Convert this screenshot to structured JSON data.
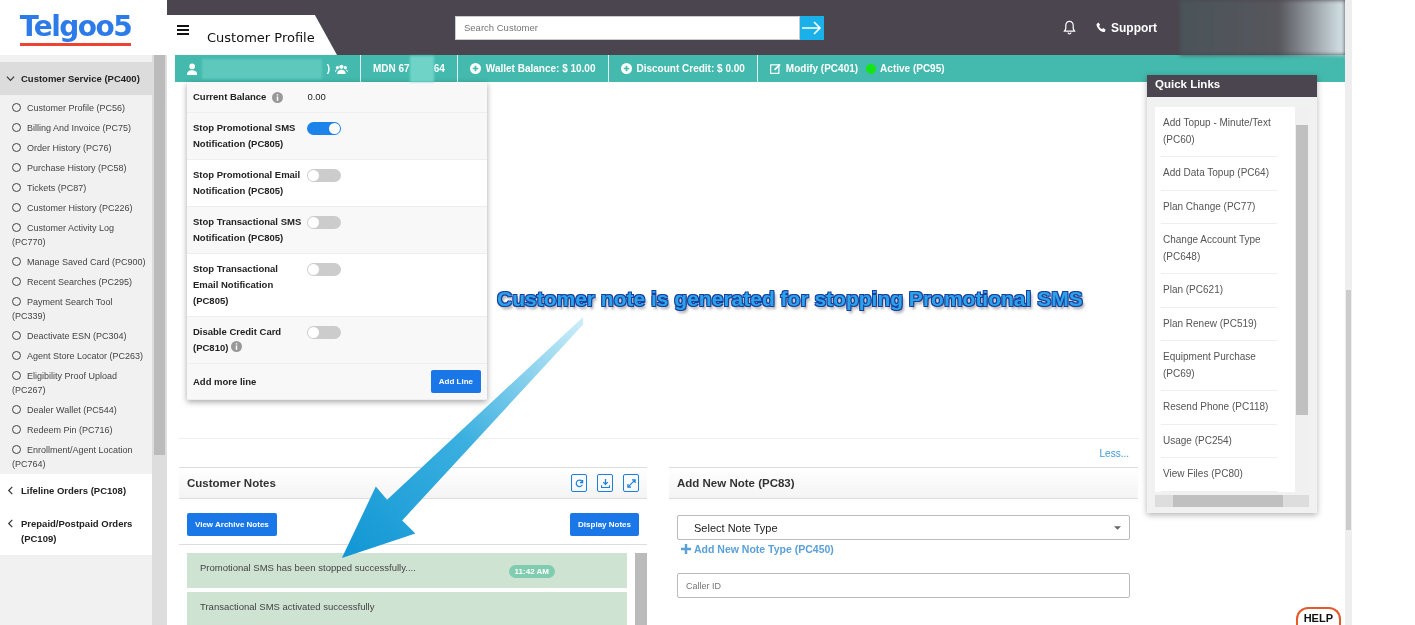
{
  "header": {
    "logo": "Telgoo5",
    "page_title": "Customer Profile",
    "search": {
      "placeholder": "Search Customer"
    },
    "support": "Support"
  },
  "sidebar": {
    "groups": [
      {
        "label": "Customer Service (PC400)",
        "expanded": true,
        "children": [
          "Customer Profile (PC56)",
          "Billing And Invoice (PC75)",
          "Order History (PC76)",
          "Purchase History (PC58)",
          "Tickets (PC87)",
          "Customer History (PC226)",
          "Customer Activity Log (PC770)",
          "Manage Saved Card (PC900)",
          "Recent Searches (PC295)",
          "Payment Search Tool (PC339)",
          "Deactivate ESN (PC304)",
          "Agent Store Locator (PC263)",
          "Eligibility Proof Upload (PC267)",
          "Dealer Wallet (PC544)",
          "Redeem Pin (PC716)",
          "Enrollment/Agent Location (PC764)"
        ]
      },
      {
        "label": "Lifeline Orders (PC108)",
        "expanded": false
      },
      {
        "label": "Prepaid/Postpaid Orders (PC109)",
        "expanded": false
      }
    ]
  },
  "customer_bar": {
    "name_end": ")",
    "mdn": "MDN 67",
    "mdn_end": "64",
    "wallet": "Wallet Balance: $ 10.00",
    "discount": "Discount Credit: $ 0.00",
    "modify": "Modify (PC401)",
    "status": "Active (PC95)"
  },
  "settings": {
    "balance_label": "Current Balance",
    "balance_value": "0.00",
    "toggles": [
      {
        "label": "Stop Promotional SMS Notification (PC805)",
        "on": true,
        "info": false
      },
      {
        "label": "Stop Promotional Email Notification (PC805)",
        "on": false,
        "info": false
      },
      {
        "label": "Stop Transactional SMS Notification (PC805)",
        "on": false,
        "info": false
      },
      {
        "label": "Stop Transactional Email Notification (PC805)",
        "on": false,
        "info": false
      },
      {
        "label": "Disable Credit Card (PC810)",
        "on": false,
        "info": true
      }
    ],
    "add_more": "Add more line",
    "add_button": "Add Line"
  },
  "less_link": "Less...",
  "customer_notes": {
    "title": "Customer Notes",
    "archive_button": "View Archive Notes",
    "display_button": "Display Notes",
    "notes": [
      {
        "text": "Promotional SMS has been stopped successfully....",
        "time": "11:42 AM"
      },
      {
        "text": "Transactional SMS activated successfully"
      }
    ]
  },
  "add_note": {
    "title": "Add New Note (PC83)",
    "note_type": {
      "value": "Select Note Type"
    },
    "add_type_link": "Add New Note Type (PC450)",
    "caller_id": {
      "placeholder": "Caller ID"
    }
  },
  "quick_links": {
    "title": "Quick Links",
    "items": [
      "Add Topup - Minute/Text (PC60)",
      "Add Data Topup (PC64)",
      "Plan Change (PC77)",
      "Change Account Type (PC648)",
      "Plan (PC621)",
      "Plan Renew (PC519)",
      "Equipment Purchase (PC69)",
      "Resend Phone (PC118)",
      "Usage (PC254)",
      "View Files (PC80)"
    ]
  },
  "help": "HELP",
  "annotation": "Customer note is generated for stopping Promotional SMS"
}
